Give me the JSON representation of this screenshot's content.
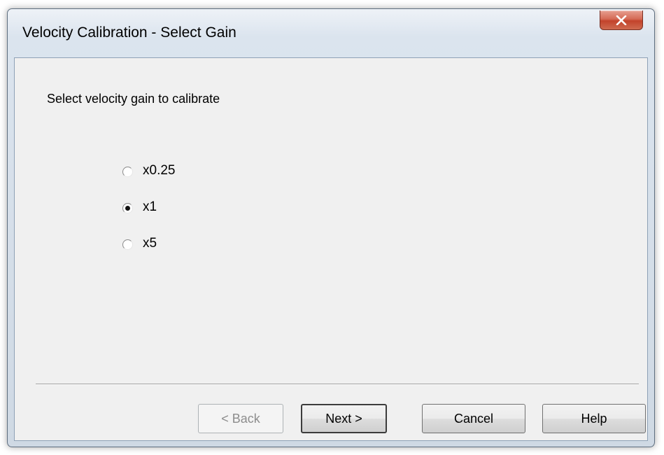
{
  "window": {
    "title": "Velocity Calibration - Select Gain"
  },
  "prompt": "Select velocity gain to calibrate",
  "gain_options": [
    {
      "label": "x0.25",
      "selected": false
    },
    {
      "label": "x1",
      "selected": true
    },
    {
      "label": "x5",
      "selected": false
    }
  ],
  "buttons": {
    "back": {
      "label": "< Back",
      "enabled": false
    },
    "next": {
      "label": "Next >",
      "enabled": true,
      "default": true
    },
    "cancel": {
      "label": "Cancel",
      "enabled": true
    },
    "help": {
      "label": "Help",
      "enabled": true
    }
  },
  "colors": {
    "close_button": "#c2432b",
    "dialog_background": "#f0f0f0"
  },
  "icons": {
    "close": "close-icon"
  }
}
